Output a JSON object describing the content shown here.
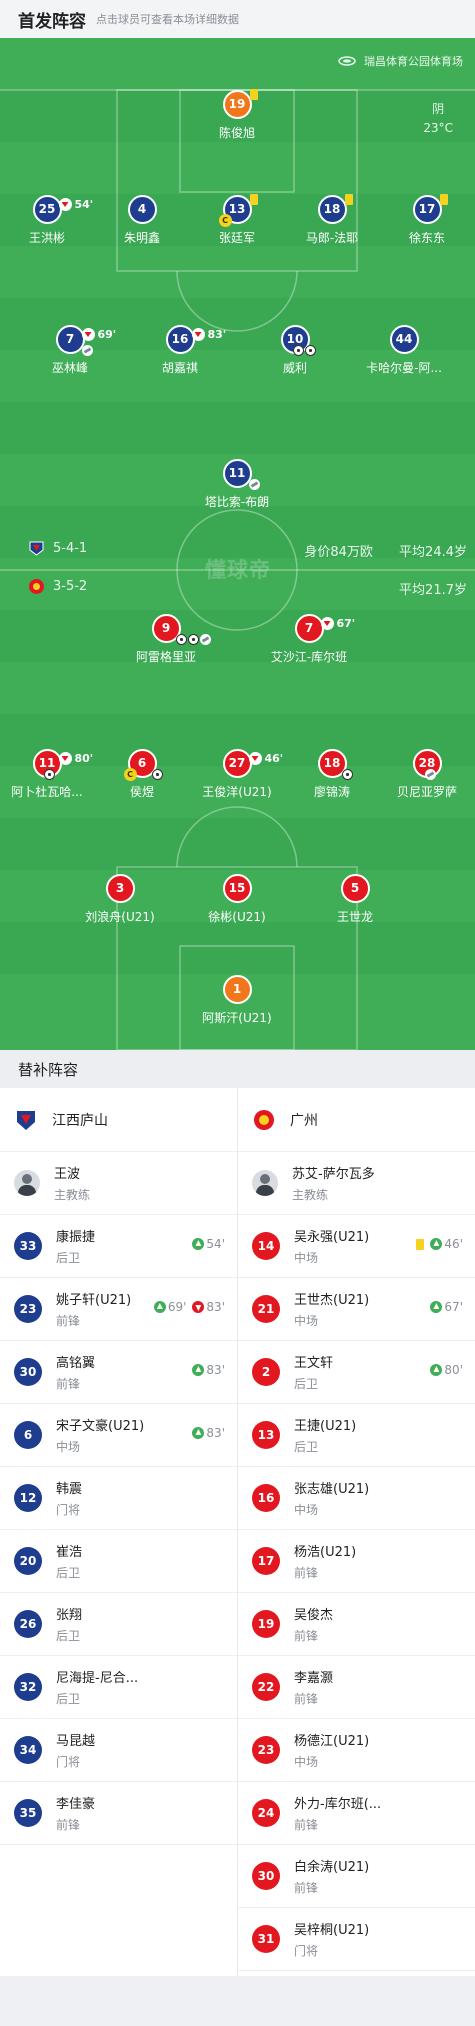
{
  "header": {
    "title": "首发阵容",
    "subtitle": "点击球员可查看本场详细数据"
  },
  "venue": {
    "name": "瑞昌体育公园体育场",
    "icon": "stadium-icon"
  },
  "weather": {
    "condition": "阴",
    "temperature": "23°C"
  },
  "watermark": "懂球帝",
  "home": {
    "name": "江西庐山",
    "formation": "5-4-1",
    "market_value": "身价84万欧",
    "avg_age": "平均24.4岁",
    "color": "#1e3d8f",
    "starters": {
      "gk": {
        "num": "19",
        "name": "陈俊旭"
      },
      "d1": {
        "num": "25",
        "name": "王洪彬",
        "out": "54'"
      },
      "d2": {
        "num": "4",
        "name": "朱明鑫"
      },
      "d3": {
        "num": "13",
        "name": "张廷军"
      },
      "d4": {
        "num": "18",
        "name": "马郎-法耶"
      },
      "d5": {
        "num": "17",
        "name": "徐东东"
      },
      "m1": {
        "num": "7",
        "name": "巫林峰",
        "out": "69'"
      },
      "m2": {
        "num": "16",
        "name": "胡嘉祺",
        "out": "83'"
      },
      "m3": {
        "num": "10",
        "name": "威利"
      },
      "m4": {
        "num": "44",
        "name": "卡哈尔曼-阿..."
      },
      "f1": {
        "num": "11",
        "name": "塔比索-布朗"
      }
    }
  },
  "away": {
    "name": "广州",
    "formation": "3-5-2",
    "avg_age": "平均21.7岁",
    "color": "#e3171f",
    "starters": {
      "f1": {
        "num": "9",
        "name": "阿雷格里亚"
      },
      "f2": {
        "num": "7",
        "name": "艾沙江-库尔班",
        "out": "67'"
      },
      "m1": {
        "num": "11",
        "name": "阿卜杜瓦哈...",
        "out": "80'"
      },
      "m2": {
        "num": "6",
        "name": "侯煜"
      },
      "m3": {
        "num": "27",
        "name": "王俊洋(U21)",
        "out": "46'"
      },
      "m4": {
        "num": "18",
        "name": "廖锦涛"
      },
      "m5": {
        "num": "28",
        "name": "贝尼亚罗萨"
      },
      "d1": {
        "num": "3",
        "name": "刘浪舟(U21)"
      },
      "d2": {
        "num": "15",
        "name": "徐彬(U21)"
      },
      "d3": {
        "num": "5",
        "name": "王世龙"
      },
      "gk": {
        "num": "1",
        "name": "阿斯汗(U21)"
      }
    }
  },
  "subs": {
    "title": "替补阵容",
    "home": {
      "name": "江西庐山",
      "coach": {
        "name": "王波",
        "role": "主教练"
      },
      "list": [
        {
          "num": "33",
          "name": "康振捷",
          "pos": "后卫",
          "in": "54'"
        },
        {
          "num": "23",
          "name": "姚子轩(U21)",
          "pos": "前锋",
          "in": "69'",
          "out": "83'"
        },
        {
          "num": "30",
          "name": "高铭翼",
          "pos": "前锋",
          "in": "83'"
        },
        {
          "num": "6",
          "name": "宋子文豪(U21)",
          "pos": "中场",
          "in": "83'"
        },
        {
          "num": "12",
          "name": "韩震",
          "pos": "门将"
        },
        {
          "num": "20",
          "name": "崔浩",
          "pos": "后卫"
        },
        {
          "num": "26",
          "name": "张翔",
          "pos": "后卫"
        },
        {
          "num": "32",
          "name": "尼海提-尼合...",
          "pos": "后卫"
        },
        {
          "num": "34",
          "name": "马昆越",
          "pos": "门将"
        },
        {
          "num": "35",
          "name": "李佳豪",
          "pos": "前锋"
        }
      ]
    },
    "away": {
      "name": "广州",
      "coach": {
        "name": "苏艾-萨尔瓦多",
        "role": "主教练"
      },
      "list": [
        {
          "num": "14",
          "name": "吴永强(U21)",
          "pos": "中场",
          "in": "46'",
          "yellow": true
        },
        {
          "num": "21",
          "name": "王世杰(U21)",
          "pos": "中场",
          "in": "67'"
        },
        {
          "num": "2",
          "name": "王文轩",
          "pos": "后卫",
          "in": "80'"
        },
        {
          "num": "13",
          "name": "王捷(U21)",
          "pos": "后卫"
        },
        {
          "num": "16",
          "name": "张志雄(U21)",
          "pos": "中场"
        },
        {
          "num": "17",
          "name": "杨浩(U21)",
          "pos": "前锋"
        },
        {
          "num": "19",
          "name": "吴俊杰",
          "pos": "前锋"
        },
        {
          "num": "22",
          "name": "李嘉灏",
          "pos": "前锋"
        },
        {
          "num": "23",
          "name": "杨德江(U21)",
          "pos": "中场"
        },
        {
          "num": "24",
          "name": "外力-库尔班(...",
          "pos": "前锋"
        },
        {
          "num": "30",
          "name": "白余涛(U21)",
          "pos": "前锋"
        },
        {
          "num": "31",
          "name": "吴梓桐(U21)",
          "pos": "门将"
        }
      ]
    }
  }
}
